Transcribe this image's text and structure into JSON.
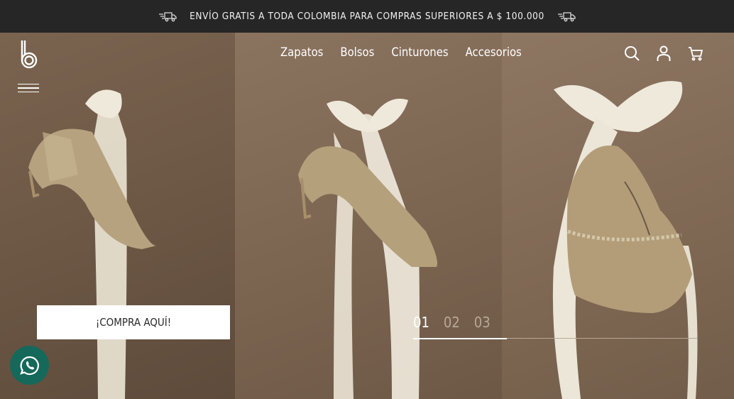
{
  "announcement": {
    "text": "ENVÍO GRATIS A TODA COLOMBIA PARA COMPRAS SUPERIORES A $ 100.000",
    "icon": "delivery-truck-icon"
  },
  "header": {
    "logo_icon": "brand-b-logo",
    "menu_icon": "hamburger-menu-icon",
    "nav": [
      "Zapatos",
      "Bolsos",
      "Cinturones",
      "Accesorios"
    ],
    "icons": [
      "search-icon",
      "account-icon",
      "cart-icon"
    ]
  },
  "hero": {
    "cta_label": "¡COMPRA AQUÍ!",
    "slides": [
      "01",
      "02",
      "03"
    ],
    "active_slide": 0,
    "progress": 0.33
  },
  "whatsapp": {
    "icon": "whatsapp-icon"
  },
  "colors": {
    "topbar": "#262626",
    "whatsapp": "#14695a",
    "cta_bg": "#ffffff"
  }
}
